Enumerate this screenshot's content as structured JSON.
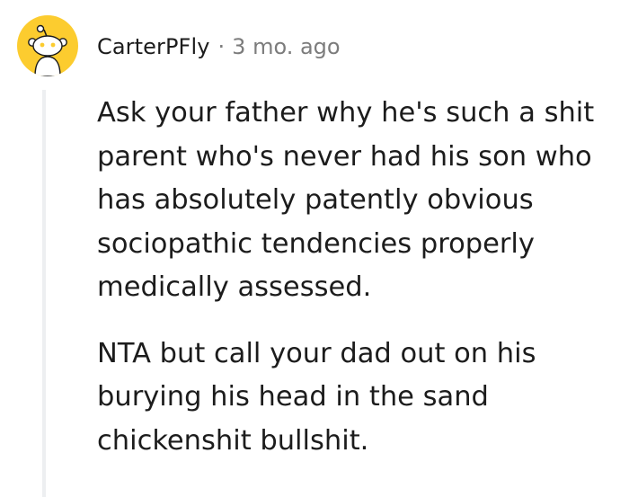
{
  "comment": {
    "username": "CarterPFly",
    "separator": "·",
    "timestamp": "3 mo. ago",
    "avatar_icon": "snoo-avatar-icon",
    "paragraphs": [
      {
        "lines": [
          "Ask your father why he's such a shit",
          "parent who's never had his son who",
          "has absolutely patently obvious",
          "sociopathic tendencies properly",
          "medically assessed."
        ]
      },
      {
        "lines": [
          "NTA but call your dad out on his",
          "burying his head in the sand",
          "chickenshit bullshit."
        ]
      }
    ]
  },
  "colors": {
    "avatar_background": "#fccc2f",
    "text": "#1c1c1c",
    "meta_text": "#7c7c7c",
    "thread_line": "#edeff1"
  }
}
